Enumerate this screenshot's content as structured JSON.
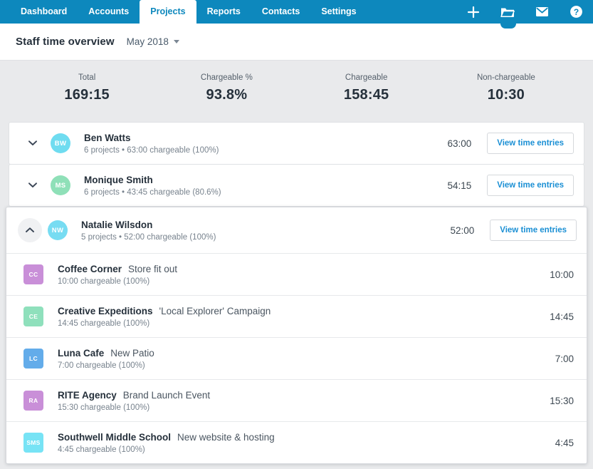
{
  "topnav": {
    "tabs": [
      {
        "label": "Dashboard",
        "active": false
      },
      {
        "label": "Accounts",
        "active": false
      },
      {
        "label": "Projects",
        "active": true
      },
      {
        "label": "Reports",
        "active": false
      },
      {
        "label": "Contacts",
        "active": false
      },
      {
        "label": "Settings",
        "active": false
      }
    ],
    "icons": [
      {
        "name": "plus-icon"
      },
      {
        "name": "folder-icon"
      },
      {
        "name": "envelope-icon"
      },
      {
        "name": "help-circle-icon"
      }
    ],
    "background_color": "#0d88bd"
  },
  "header": {
    "title": "Staff time overview",
    "period": "May 2018"
  },
  "stats": [
    {
      "label": "Total",
      "value": "169:15"
    },
    {
      "label": "Chargeable %",
      "value": "93.8%"
    },
    {
      "label": "Chargeable",
      "value": "158:45"
    },
    {
      "label": "Non-chargeable",
      "value": "10:30"
    }
  ],
  "staff": [
    {
      "name": "Ben Watts",
      "initials": "BW",
      "avatar_color": "#6fdcf0",
      "meta": "6 projects • 63:00 chargeable (100%)",
      "total": "63:00",
      "button_label": "View time entries",
      "expanded": false
    },
    {
      "name": "Monique Smith",
      "initials": "MS",
      "avatar_color": "#8fe0b8",
      "meta": "6 projects • 43:45 chargeable (80.6%)",
      "total": "54:15",
      "button_label": "View time entries",
      "expanded": false
    },
    {
      "name": "Natalie Wilsdon",
      "initials": "NW",
      "avatar_color": "#77dcf2",
      "meta": "5 projects • 52:00 chargeable (100%)",
      "total": "52:00",
      "button_label": "View time entries",
      "expanded": true,
      "projects": [
        {
          "initials": "CC",
          "tile_color": "#c98fd8",
          "client": "Coffee Corner",
          "name": "Store fit out",
          "meta": "10:00 chargeable (100%)",
          "total": "10:00"
        },
        {
          "initials": "CE",
          "tile_color": "#8fe0bc",
          "client": "Creative Expeditions",
          "name": "'Local Explorer' Campaign",
          "meta": "14:45 chargeable (100%)",
          "total": "14:45"
        },
        {
          "initials": "LC",
          "tile_color": "#63acea",
          "client": "Luna Cafe",
          "name": "New Patio",
          "meta": "7:00 chargeable (100%)",
          "total": "7:00"
        },
        {
          "initials": "RA",
          "tile_color": "#c98fd8",
          "client": "RITE Agency",
          "name": "Brand Launch Event",
          "meta": "15:30 chargeable (100%)",
          "total": "15:30"
        },
        {
          "initials": "SMS",
          "tile_color": "#77e3f5",
          "client": "Southwell Middle School",
          "name": "New website & hosting",
          "meta": "4:45 chargeable (100%)",
          "total": "4:45"
        }
      ]
    }
  ],
  "colors": {
    "brand": "#0d88bd",
    "link": "#1a8fd4",
    "page_background": "#e9eaec",
    "text_dark": "#25303b",
    "text_muted": "#78838e"
  }
}
